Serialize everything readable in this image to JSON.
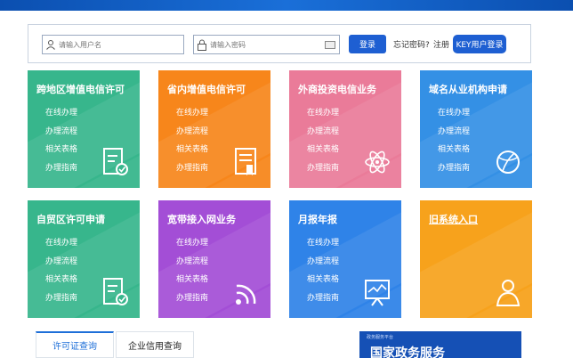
{
  "login": {
    "username_placeholder": "请输入用户名",
    "password_placeholder": "请输入密码",
    "login_button": "登录",
    "forgot_password": "忘记密码?",
    "register": "注册",
    "key_login_button": "KEY用户登录"
  },
  "tiles": [
    {
      "title": "跨地区增值电信许可",
      "links": [
        "在线办理",
        "办理流程",
        "相关表格",
        "办理指南"
      ],
      "icon": "form-check-icon"
    },
    {
      "title": "省内增值电信许可",
      "links": [
        "在线办理",
        "办理流程",
        "相关表格",
        "办理指南"
      ],
      "icon": "document-bookmark-icon"
    },
    {
      "title": "外商投资电信业务",
      "links": [
        "在线办理",
        "办理流程",
        "相关表格",
        "办理指南"
      ],
      "icon": "atom-icon"
    },
    {
      "title": "域名从业机构申请",
      "links": [
        "在线办理",
        "办理流程",
        "相关表格",
        "办理指南"
      ],
      "icon": "globe-icon"
    },
    {
      "title": "自贸区许可申请",
      "links": [
        "在线办理",
        "办理流程",
        "相关表格",
        "办理指南"
      ],
      "icon": "form-check-icon"
    },
    {
      "title": "宽带接入网业务",
      "links": [
        "在线办理",
        "办理流程",
        "相关表格",
        "办理指南"
      ],
      "icon": "wifi-signal-icon"
    },
    {
      "title": "月报年报",
      "links": [
        "在线办理",
        "办理流程",
        "相关表格",
        "办理指南"
      ],
      "icon": "monitor-chart-icon"
    },
    {
      "title": "旧系统入口",
      "links": [],
      "icon": "user-icon"
    }
  ],
  "tabs": [
    "许可证查询",
    "企业信用查询"
  ],
  "promo": {
    "small": "政务服务平台",
    "big": "国家政务服务"
  },
  "colors": {
    "accent": "#1e5fd2",
    "green": "#37b68c",
    "orange": "#f7861b",
    "pink": "#ea7b99",
    "blue": "#3490e5",
    "purple": "#a34ed6",
    "amber": "#f7a21c"
  }
}
